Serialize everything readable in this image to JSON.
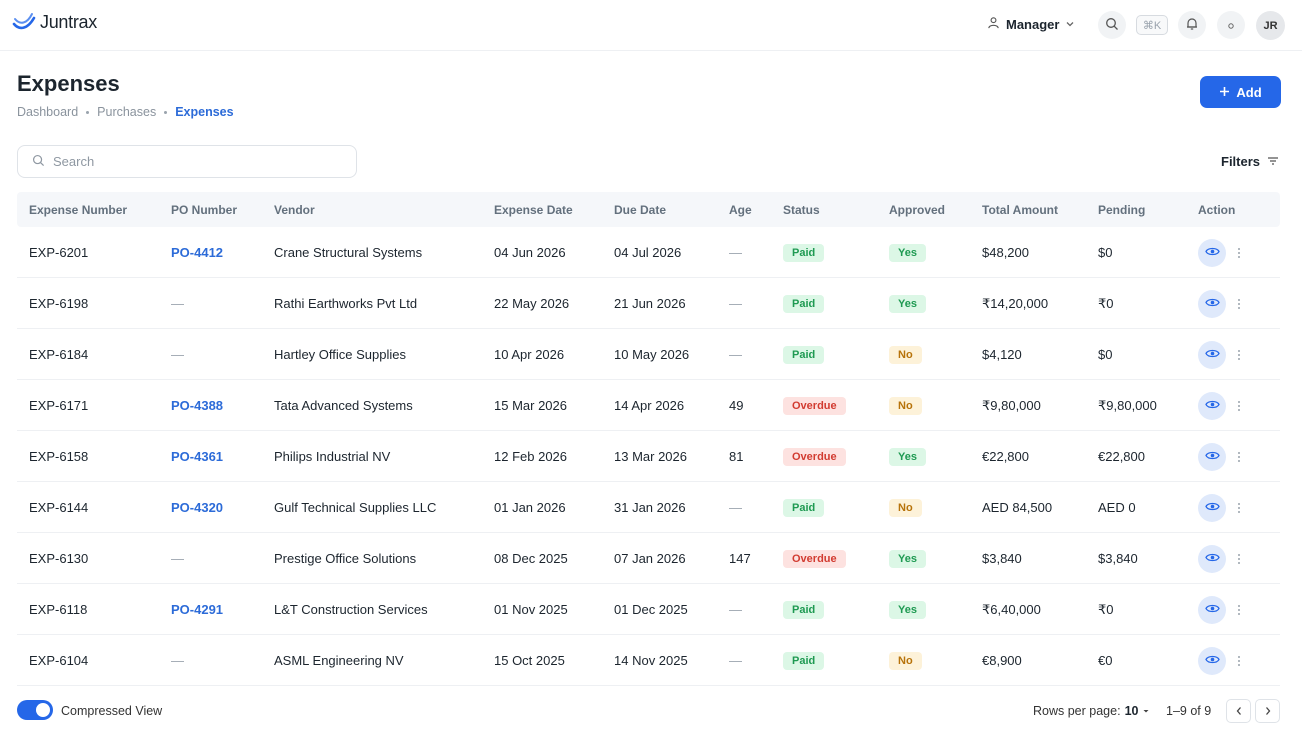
{
  "header": {
    "brand": "Juntrax",
    "role": "Manager",
    "shortcut": "⌘K",
    "avatar_initials": "JR"
  },
  "page": {
    "title": "Expenses",
    "breadcrumb": [
      "Dashboard",
      "Purchases",
      "Expenses"
    ],
    "add_label": "Add"
  },
  "search": {
    "placeholder": "Search",
    "value": ""
  },
  "filters_label": "Filters",
  "table": {
    "columns": [
      "Expense Number",
      "PO Number",
      "Vendor",
      "Expense Date",
      "Due Date",
      "Age",
      "Status",
      "Approved",
      "Total Amount",
      "Pending",
      "Action"
    ],
    "rows": [
      {
        "expense_number": "EXP-6201",
        "po_number": "PO-4412",
        "vendor": "Crane Structural Systems",
        "expense_date": "04 Jun 2026",
        "due_date": "04 Jul 2026",
        "age": "—",
        "status": "Paid",
        "approved": "Yes",
        "total": "$48,200",
        "pending": "$0"
      },
      {
        "expense_number": "EXP-6198",
        "po_number": "—",
        "vendor": "Rathi Earthworks Pvt Ltd",
        "expense_date": "22 May 2026",
        "due_date": "21 Jun 2026",
        "age": "—",
        "status": "Paid",
        "approved": "Yes",
        "total": "₹14,20,000",
        "pending": "₹0"
      },
      {
        "expense_number": "EXP-6184",
        "po_number": "—",
        "vendor": "Hartley Office Supplies",
        "expense_date": "10 Apr 2026",
        "due_date": "10 May 2026",
        "age": "—",
        "status": "Paid",
        "approved": "No",
        "total": "$4,120",
        "pending": "$0"
      },
      {
        "expense_number": "EXP-6171",
        "po_number": "PO-4388",
        "vendor": "Tata Advanced Systems",
        "expense_date": "15 Mar 2026",
        "due_date": "14 Apr 2026",
        "age": "49",
        "status": "Overdue",
        "approved": "No",
        "total": "₹9,80,000",
        "pending": "₹9,80,000"
      },
      {
        "expense_number": "EXP-6158",
        "po_number": "PO-4361",
        "vendor": "Philips Industrial NV",
        "expense_date": "12 Feb 2026",
        "due_date": "13 Mar 2026",
        "age": "81",
        "status": "Overdue",
        "approved": "Yes",
        "total": "€22,800",
        "pending": "€22,800"
      },
      {
        "expense_number": "EXP-6144",
        "po_number": "PO-4320",
        "vendor": "Gulf Technical Supplies LLC",
        "expense_date": "01 Jan 2026",
        "due_date": "31 Jan 2026",
        "age": "—",
        "status": "Paid",
        "approved": "No",
        "total": "AED 84,500",
        "pending": "AED 0"
      },
      {
        "expense_number": "EXP-6130",
        "po_number": "—",
        "vendor": "Prestige Office Solutions",
        "expense_date": "08 Dec 2025",
        "due_date": "07 Jan 2026",
        "age": "147",
        "status": "Overdue",
        "approved": "Yes",
        "total": "$3,840",
        "pending": "$3,840"
      },
      {
        "expense_number": "EXP-6118",
        "po_number": "PO-4291",
        "vendor": "L&T Construction Services",
        "expense_date": "01 Nov 2025",
        "due_date": "01 Dec 2025",
        "age": "—",
        "status": "Paid",
        "approved": "Yes",
        "total": "₹6,40,000",
        "pending": "₹0"
      },
      {
        "expense_number": "EXP-6104",
        "po_number": "—",
        "vendor": "ASML Engineering NV",
        "expense_date": "15 Oct 2025",
        "due_date": "14 Nov 2025",
        "age": "—",
        "status": "Paid",
        "approved": "No",
        "total": "€8,900",
        "pending": "€0"
      }
    ]
  },
  "footer": {
    "compressed_view_label": "Compressed View",
    "compressed_view_on": true,
    "rows_per_page_label": "Rows per page:",
    "rows_per_page_value": "10",
    "range_label": "1–9 of 9"
  },
  "colors": {
    "accent": "#2567e8",
    "link": "#2c6bd8",
    "paid": "#1f9a52",
    "overdue": "#d23b30",
    "no": "#b7730a"
  }
}
